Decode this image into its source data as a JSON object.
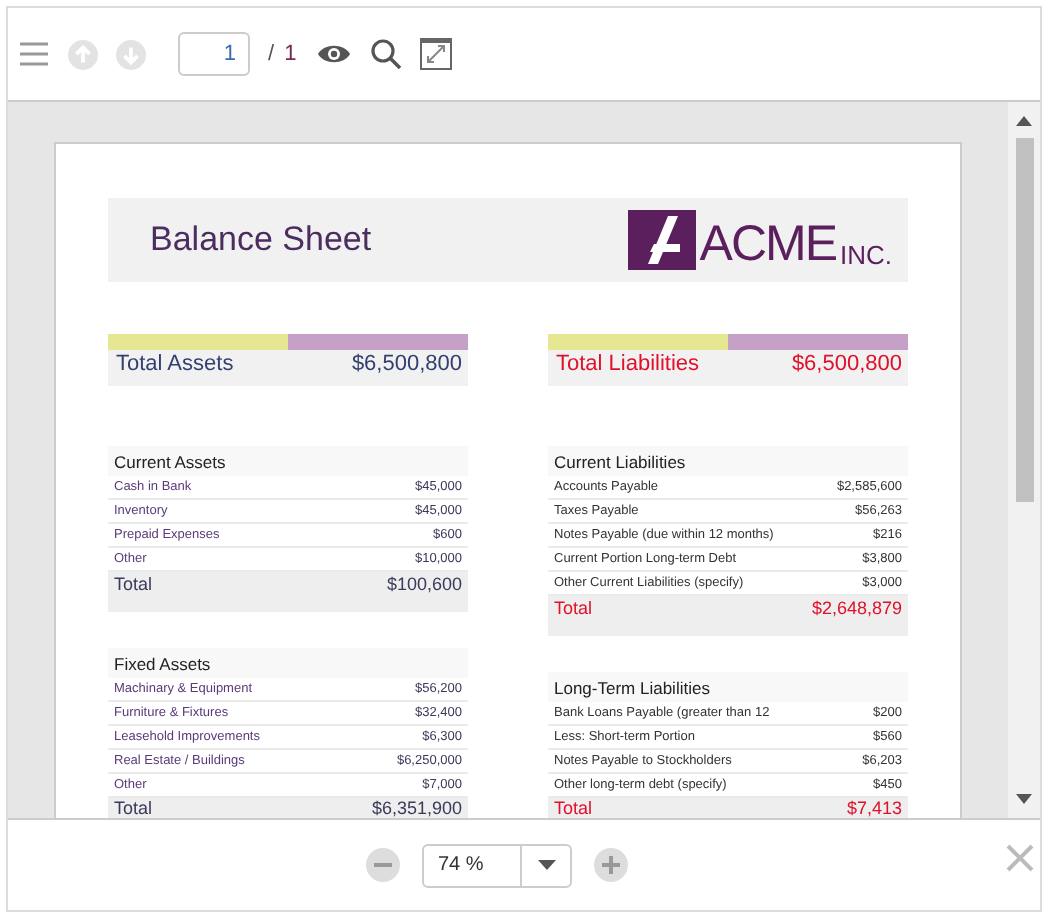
{
  "toolbar": {
    "page_input": "1",
    "page_separator": "/",
    "page_total": "1"
  },
  "report": {
    "title": "Balance Sheet",
    "logo": {
      "mark": "ACME",
      "suffix": "INC."
    },
    "columns": [
      {
        "kind": "assets",
        "summary": {
          "label": "Total Assets",
          "value": "$6,500,800"
        },
        "sections": [
          {
            "title": "Current Assets",
            "rows": [
              {
                "label": "Cash in Bank",
                "value": "$45,000"
              },
              {
                "label": "Inventory",
                "value": "$45,000"
              },
              {
                "label": "Prepaid Expenses",
                "value": "$600"
              },
              {
                "label": "Other",
                "value": "$10,000"
              }
            ],
            "total": {
              "label": "Total",
              "value": "$100,600"
            }
          },
          {
            "title": "Fixed Assets",
            "rows": [
              {
                "label": "Machinary & Equipment",
                "value": "$56,200"
              },
              {
                "label": "Furniture & Fixtures",
                "value": "$32,400"
              },
              {
                "label": "Leasehold Improvements",
                "value": "$6,300"
              },
              {
                "label": "Real Estate / Buildings",
                "value": "$6,250,000"
              },
              {
                "label": "Other",
                "value": "$7,000"
              }
            ],
            "total": {
              "label": "Total",
              "value": "$6,351,900"
            }
          }
        ]
      },
      {
        "kind": "liabilities",
        "summary": {
          "label": "Total Liabilities",
          "value": "$6,500,800"
        },
        "sections": [
          {
            "title": "Current Liabilities",
            "rows": [
              {
                "label": "Accounts Payable",
                "value": "$2,585,600"
              },
              {
                "label": "Taxes Payable",
                "value": "$56,263"
              },
              {
                "label": "Notes Payable (due within 12 months)",
                "value": "$216"
              },
              {
                "label": "Current Portion Long-term Debt",
                "value": "$3,800"
              },
              {
                "label": "Other Current Liabilities (specify)",
                "value": "$3,000"
              }
            ],
            "total": {
              "label": "Total",
              "value": "$2,648,879"
            }
          },
          {
            "title": "Long-Term Liabilities",
            "rows": [
              {
                "label": "Bank Loans Payable (greater than 12",
                "value": "$200"
              },
              {
                "label": "Less: Short-term Portion",
                "value": "$560"
              },
              {
                "label": "Notes Payable to Stockholders",
                "value": "$6,203"
              },
              {
                "label": "Other long-term debt (specify)",
                "value": "$450"
              }
            ],
            "total": {
              "label": "Total",
              "value": "$7,413"
            }
          }
        ]
      }
    ]
  },
  "zoom": {
    "value": "74 %"
  }
}
